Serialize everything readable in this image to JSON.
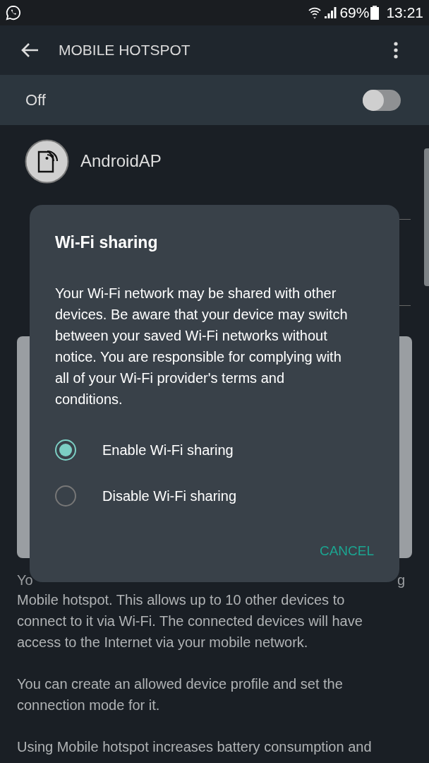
{
  "status_bar": {
    "battery": "69%",
    "time": "13:21"
  },
  "app_bar": {
    "title": "MOBILE HOTSPOT"
  },
  "master_switch": {
    "label": "Off",
    "on": false
  },
  "network": {
    "name": "AndroidAP"
  },
  "background_fragments": [
    "Yo",
    "g"
  ],
  "dialog": {
    "title": "Wi-Fi sharing",
    "message": "Your Wi-Fi network may be shared with other devices. Be aware that your device may switch between your saved Wi-Fi networks without notice. You are responsible for complying with all of your Wi-Fi provider's terms and conditions.",
    "options": [
      {
        "label": "Enable Wi-Fi sharing",
        "selected": true
      },
      {
        "label": "Disable Wi-Fi sharing",
        "selected": false
      }
    ],
    "buttons": [
      "CANCEL"
    ]
  },
  "description": [
    "Mobile hotspot. This allows up to 10 other devices to connect to it via Wi-Fi. The connected devices will have access to the Internet via your mobile network.",
    "You can create an allowed device profile and set the connection mode for it.",
    "Using Mobile hotspot increases battery consumption and"
  ]
}
